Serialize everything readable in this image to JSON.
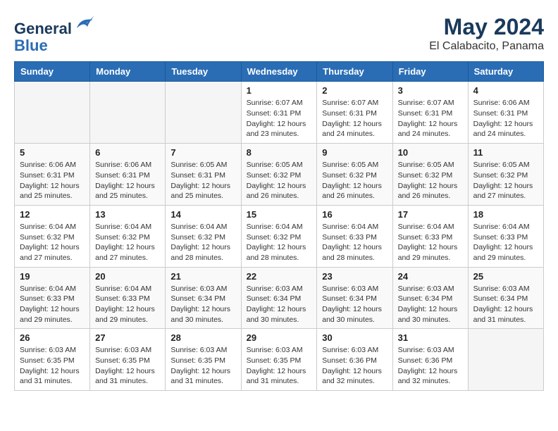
{
  "header": {
    "logo_line1": "General",
    "logo_line2": "Blue",
    "month_title": "May 2024",
    "location": "El Calabacito, Panama"
  },
  "weekdays": [
    "Sunday",
    "Monday",
    "Tuesday",
    "Wednesday",
    "Thursday",
    "Friday",
    "Saturday"
  ],
  "weeks": [
    [
      {
        "day": "",
        "sunrise": "",
        "sunset": "",
        "daylight": "",
        "empty": true
      },
      {
        "day": "",
        "sunrise": "",
        "sunset": "",
        "daylight": "",
        "empty": true
      },
      {
        "day": "",
        "sunrise": "",
        "sunset": "",
        "daylight": "",
        "empty": true
      },
      {
        "day": "1",
        "sunrise": "6:07 AM",
        "sunset": "6:31 PM",
        "daylight": "12 hours and 23 minutes.",
        "empty": false
      },
      {
        "day": "2",
        "sunrise": "6:07 AM",
        "sunset": "6:31 PM",
        "daylight": "12 hours and 24 minutes.",
        "empty": false
      },
      {
        "day": "3",
        "sunrise": "6:07 AM",
        "sunset": "6:31 PM",
        "daylight": "12 hours and 24 minutes.",
        "empty": false
      },
      {
        "day": "4",
        "sunrise": "6:06 AM",
        "sunset": "6:31 PM",
        "daylight": "12 hours and 24 minutes.",
        "empty": false
      }
    ],
    [
      {
        "day": "5",
        "sunrise": "6:06 AM",
        "sunset": "6:31 PM",
        "daylight": "12 hours and 25 minutes.",
        "empty": false
      },
      {
        "day": "6",
        "sunrise": "6:06 AM",
        "sunset": "6:31 PM",
        "daylight": "12 hours and 25 minutes.",
        "empty": false
      },
      {
        "day": "7",
        "sunrise": "6:05 AM",
        "sunset": "6:31 PM",
        "daylight": "12 hours and 25 minutes.",
        "empty": false
      },
      {
        "day": "8",
        "sunrise": "6:05 AM",
        "sunset": "6:32 PM",
        "daylight": "12 hours and 26 minutes.",
        "empty": false
      },
      {
        "day": "9",
        "sunrise": "6:05 AM",
        "sunset": "6:32 PM",
        "daylight": "12 hours and 26 minutes.",
        "empty": false
      },
      {
        "day": "10",
        "sunrise": "6:05 AM",
        "sunset": "6:32 PM",
        "daylight": "12 hours and 26 minutes.",
        "empty": false
      },
      {
        "day": "11",
        "sunrise": "6:05 AM",
        "sunset": "6:32 PM",
        "daylight": "12 hours and 27 minutes.",
        "empty": false
      }
    ],
    [
      {
        "day": "12",
        "sunrise": "6:04 AM",
        "sunset": "6:32 PM",
        "daylight": "12 hours and 27 minutes.",
        "empty": false
      },
      {
        "day": "13",
        "sunrise": "6:04 AM",
        "sunset": "6:32 PM",
        "daylight": "12 hours and 27 minutes.",
        "empty": false
      },
      {
        "day": "14",
        "sunrise": "6:04 AM",
        "sunset": "6:32 PM",
        "daylight": "12 hours and 28 minutes.",
        "empty": false
      },
      {
        "day": "15",
        "sunrise": "6:04 AM",
        "sunset": "6:32 PM",
        "daylight": "12 hours and 28 minutes.",
        "empty": false
      },
      {
        "day": "16",
        "sunrise": "6:04 AM",
        "sunset": "6:33 PM",
        "daylight": "12 hours and 28 minutes.",
        "empty": false
      },
      {
        "day": "17",
        "sunrise": "6:04 AM",
        "sunset": "6:33 PM",
        "daylight": "12 hours and 29 minutes.",
        "empty": false
      },
      {
        "day": "18",
        "sunrise": "6:04 AM",
        "sunset": "6:33 PM",
        "daylight": "12 hours and 29 minutes.",
        "empty": false
      }
    ],
    [
      {
        "day": "19",
        "sunrise": "6:04 AM",
        "sunset": "6:33 PM",
        "daylight": "12 hours and 29 minutes.",
        "empty": false
      },
      {
        "day": "20",
        "sunrise": "6:04 AM",
        "sunset": "6:33 PM",
        "daylight": "12 hours and 29 minutes.",
        "empty": false
      },
      {
        "day": "21",
        "sunrise": "6:03 AM",
        "sunset": "6:34 PM",
        "daylight": "12 hours and 30 minutes.",
        "empty": false
      },
      {
        "day": "22",
        "sunrise": "6:03 AM",
        "sunset": "6:34 PM",
        "daylight": "12 hours and 30 minutes.",
        "empty": false
      },
      {
        "day": "23",
        "sunrise": "6:03 AM",
        "sunset": "6:34 PM",
        "daylight": "12 hours and 30 minutes.",
        "empty": false
      },
      {
        "day": "24",
        "sunrise": "6:03 AM",
        "sunset": "6:34 PM",
        "daylight": "12 hours and 30 minutes.",
        "empty": false
      },
      {
        "day": "25",
        "sunrise": "6:03 AM",
        "sunset": "6:34 PM",
        "daylight": "12 hours and 31 minutes.",
        "empty": false
      }
    ],
    [
      {
        "day": "26",
        "sunrise": "6:03 AM",
        "sunset": "6:35 PM",
        "daylight": "12 hours and 31 minutes.",
        "empty": false
      },
      {
        "day": "27",
        "sunrise": "6:03 AM",
        "sunset": "6:35 PM",
        "daylight": "12 hours and 31 minutes.",
        "empty": false
      },
      {
        "day": "28",
        "sunrise": "6:03 AM",
        "sunset": "6:35 PM",
        "daylight": "12 hours and 31 minutes.",
        "empty": false
      },
      {
        "day": "29",
        "sunrise": "6:03 AM",
        "sunset": "6:35 PM",
        "daylight": "12 hours and 31 minutes.",
        "empty": false
      },
      {
        "day": "30",
        "sunrise": "6:03 AM",
        "sunset": "6:36 PM",
        "daylight": "12 hours and 32 minutes.",
        "empty": false
      },
      {
        "day": "31",
        "sunrise": "6:03 AM",
        "sunset": "6:36 PM",
        "daylight": "12 hours and 32 minutes.",
        "empty": false
      },
      {
        "day": "",
        "sunrise": "",
        "sunset": "",
        "daylight": "",
        "empty": true
      }
    ]
  ]
}
